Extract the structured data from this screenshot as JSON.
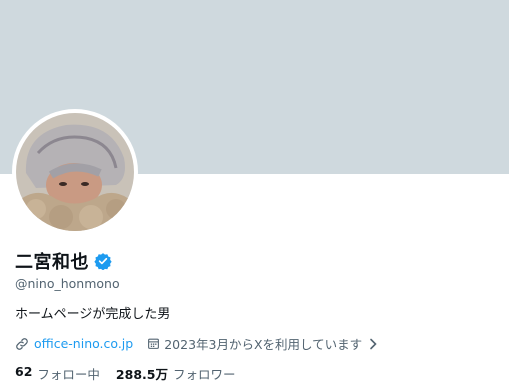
{
  "profile": {
    "name": "二宮和也",
    "handle": "@nino_honmono",
    "bio": "ホームページが完成した男",
    "website": "office-nino.co.jp",
    "joined": "2023年3月からXを利用しています",
    "following_count": "62",
    "following_label": "フォロー中",
    "followers_count": "288.5万",
    "followers_label": "フォロワー"
  },
  "icons": {
    "verified": "verified-badge-icon",
    "link": "link-icon",
    "calendar": "calendar-icon",
    "chevron": "chevron-right-icon"
  },
  "colors": {
    "banner": "#cfd9de",
    "accent": "#1d9bf0",
    "text_secondary": "#536471"
  }
}
